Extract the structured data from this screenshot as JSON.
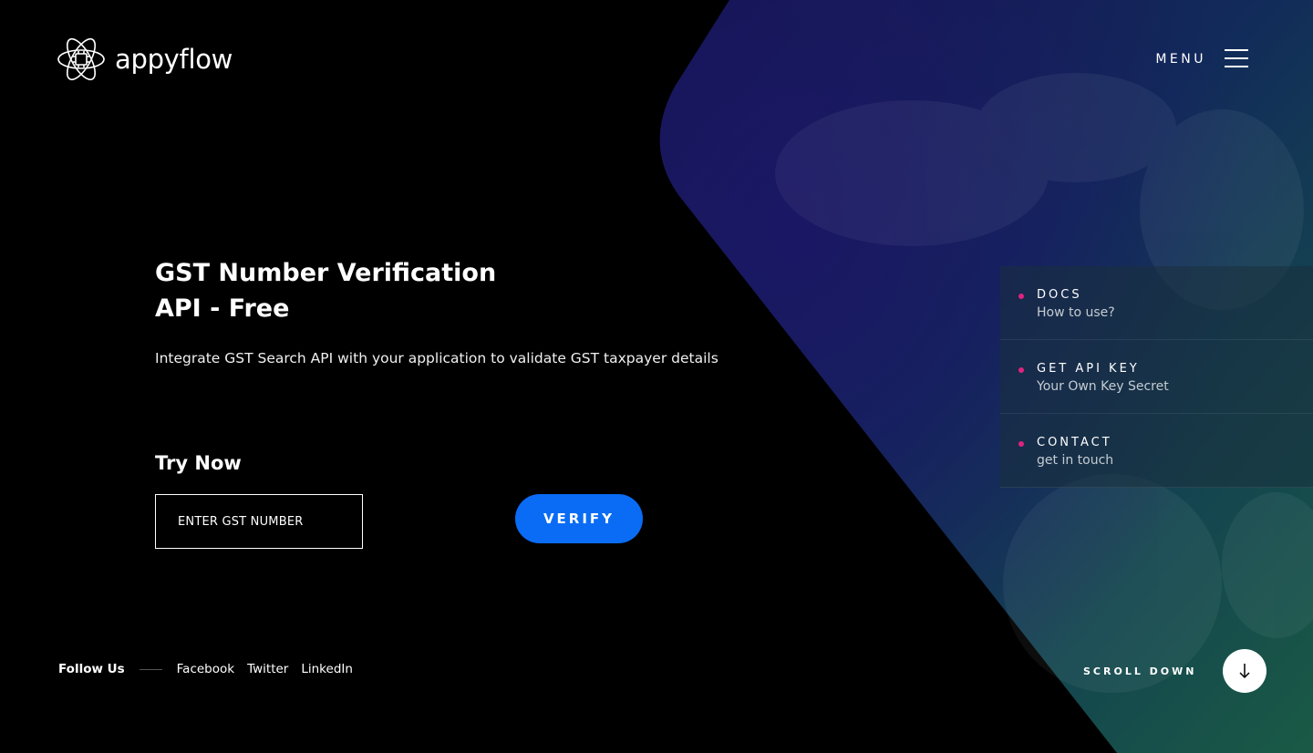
{
  "brand": {
    "name": "appyflow"
  },
  "header": {
    "menu_label": "MENU"
  },
  "hero": {
    "title_line1": "GST Number Verification",
    "title_line2": "API - Free",
    "subtitle": "Integrate GST Search API with your application to validate GST taxpayer details"
  },
  "try_now": {
    "title": "Try Now",
    "input_placeholder": "ENTER GST NUMBER",
    "button_label": "VERIFY"
  },
  "side_menu": [
    {
      "title": "DOCS",
      "desc": "How to use?"
    },
    {
      "title": "GET API KEY",
      "desc": "Your Own Key Secret"
    },
    {
      "title": "CONTACT",
      "desc": "get in touch"
    }
  ],
  "footer": {
    "follow_label": "Follow Us",
    "links": [
      "Facebook",
      "Twitter",
      "LinkedIn"
    ],
    "scroll_label": "SCROLL DOWN"
  },
  "colors": {
    "accent": "#0a6cf5",
    "dot": "#e0237f",
    "background": "#000000"
  }
}
